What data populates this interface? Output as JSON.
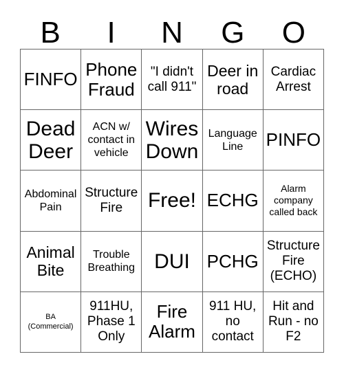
{
  "card": {
    "header_letters": [
      "B",
      "I",
      "N",
      "G",
      "O"
    ],
    "background_color": "#ffffff",
    "text_color": "#000000",
    "border_color": "#666666",
    "rows": [
      [
        {
          "text": "FINFO",
          "size": "xl"
        },
        {
          "text": "Phone Fraud",
          "size": "xl"
        },
        {
          "text": "\"I didn't call 911\"",
          "size": "md"
        },
        {
          "text": "Deer in road",
          "size": "lg"
        },
        {
          "text": "Cardiac Arrest",
          "size": "md"
        }
      ],
      [
        {
          "text": "Dead Deer",
          "size": "xxl"
        },
        {
          "text": "ACN w/ contact in vehicle",
          "size": "sm"
        },
        {
          "text": "Wires Down",
          "size": "xxl"
        },
        {
          "text": "Language Line",
          "size": "sm"
        },
        {
          "text": "PINFO",
          "size": "xl"
        }
      ],
      [
        {
          "text": "Abdominal Pain",
          "size": "sm"
        },
        {
          "text": "Structure Fire",
          "size": "md"
        },
        {
          "text": "Free!",
          "size": "xxl"
        },
        {
          "text": "ECHG",
          "size": "xl"
        },
        {
          "text": "Alarm company called back",
          "size": "xs"
        }
      ],
      [
        {
          "text": "Animal Bite",
          "size": "lg"
        },
        {
          "text": "Trouble Breathing",
          "size": "sm"
        },
        {
          "text": "DUI",
          "size": "xxl"
        },
        {
          "text": "PCHG",
          "size": "xl"
        },
        {
          "text": "Structure Fire (ECHO)",
          "size": "md"
        }
      ],
      [
        {
          "text": "BA (Commercial)",
          "size": "xxs"
        },
        {
          "text": "911HU, Phase 1 Only",
          "size": "md"
        },
        {
          "text": "Fire Alarm",
          "size": "xl"
        },
        {
          "text": "911 HU, no contact",
          "size": "md"
        },
        {
          "text": "Hit and Run - no F2",
          "size": "md"
        }
      ]
    ]
  }
}
